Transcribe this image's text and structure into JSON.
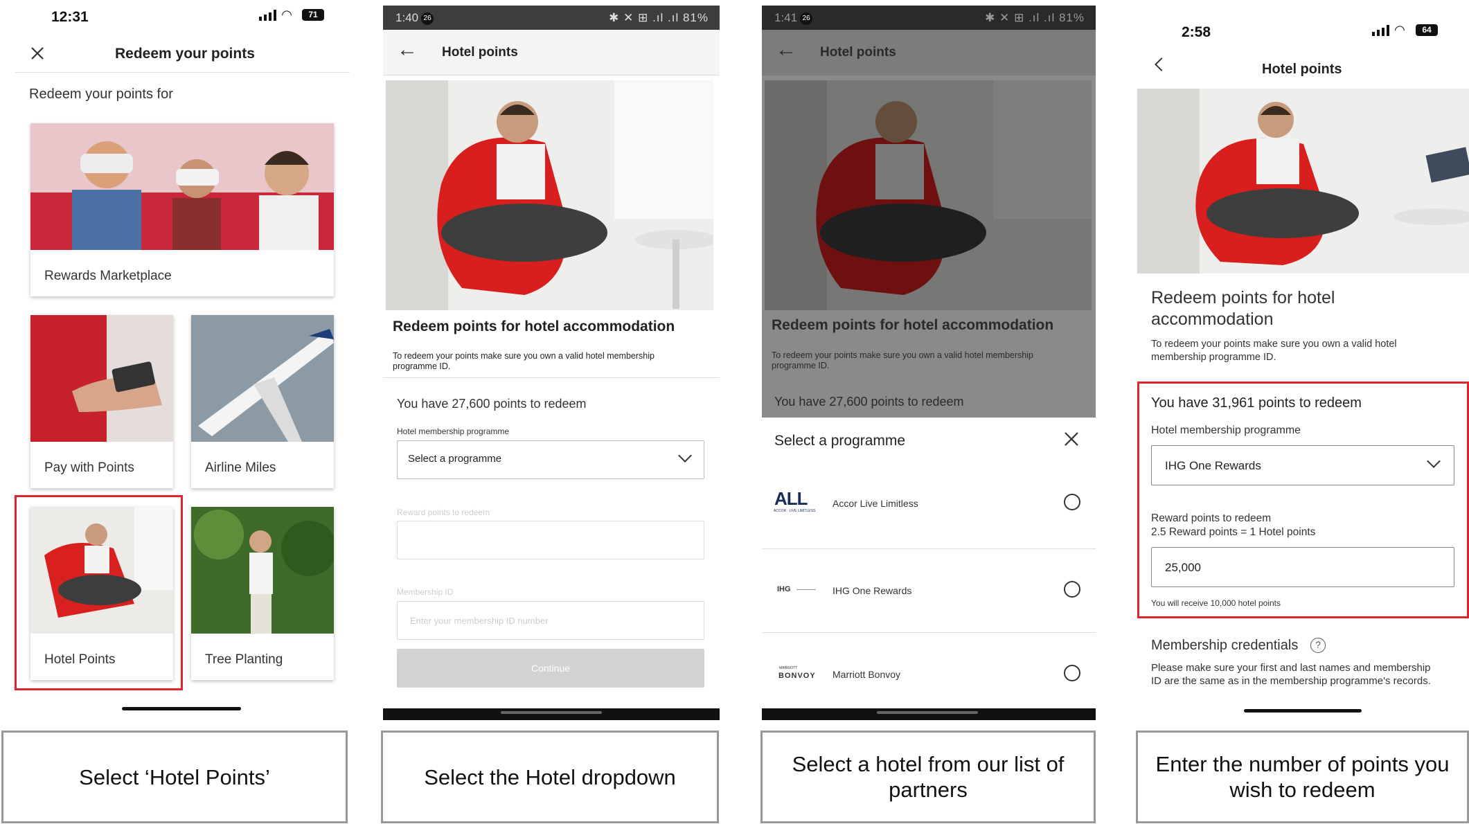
{
  "screen1": {
    "time": "12:31",
    "battery": "71",
    "header_title": "Redeem your points",
    "subtitle": "Redeem your points for",
    "cards": [
      {
        "label": "Rewards Marketplace"
      },
      {
        "label": "Pay with Points"
      },
      {
        "label": "Airline Miles"
      },
      {
        "label": "Hotel Points"
      },
      {
        "label": "Tree Planting"
      }
    ]
  },
  "screen2": {
    "time": "1:40",
    "notif_badge": "26",
    "status_right": "✱ ✕ ⊞ .ıl .ıl 81%",
    "header_title": "Hotel points",
    "heading": "Redeem points for hotel accommodation",
    "info": "To redeem your points make sure you own a valid hotel membership programme ID.",
    "points_text": "You have 27,600 points to redeem",
    "programme_label": "Hotel membership programme",
    "programme_value": "Select a programme",
    "reward_label": "Reward points to redeem",
    "membership_label": "Membership ID",
    "membership_placeholder": "Enter your membership ID number",
    "continue_label": "Continue"
  },
  "screen3": {
    "time": "1:41",
    "notif_badge": "26",
    "status_right": "✱ ✕ ⊞ .ıl .ıl 81%",
    "header_title": "Hotel points",
    "heading": "Redeem points for hotel accommodation",
    "info": "To redeem your points make sure you own a valid hotel membership programme ID.",
    "points_text": "You have 27,600 points to redeem",
    "sheet_title": "Select a programme",
    "options": [
      {
        "logo": "ALL",
        "logo_sub": "ACCOR · LIVE LIMITLESS",
        "name": "Accor Live Limitless"
      },
      {
        "logo": "IHG",
        "logo_sub": "",
        "name": "IHG One Rewards"
      },
      {
        "logo": "BONVOY",
        "logo_sub": "MARRIOTT",
        "name": "Marriott Bonvoy"
      }
    ]
  },
  "screen4": {
    "time": "2:58",
    "battery": "64",
    "header_title": "Hotel points",
    "heading": "Redeem points for hotel accommodation",
    "info": "To redeem your points make sure you own a valid hotel membership programme ID.",
    "points_text": "You have 31,961 points to redeem",
    "programme_label": "Hotel membership programme",
    "programme_value": "IHG One Rewards",
    "reward_label": "Reward points to redeem",
    "rate_text": "2.5 Reward points = 1 Hotel points",
    "reward_value": "25,000",
    "receive_text": "You will receive 10,000 hotel points",
    "credentials_title": "Membership credentials",
    "credentials_info": "Please make sure your first and last names and membership ID are the same as in the membership programme's records."
  },
  "instructions": [
    "Select ‘Hotel Points’",
    "Select the Hotel dropdown",
    "Select a hotel from our list of partners",
    "Enter the number of points you wish to redeem"
  ]
}
